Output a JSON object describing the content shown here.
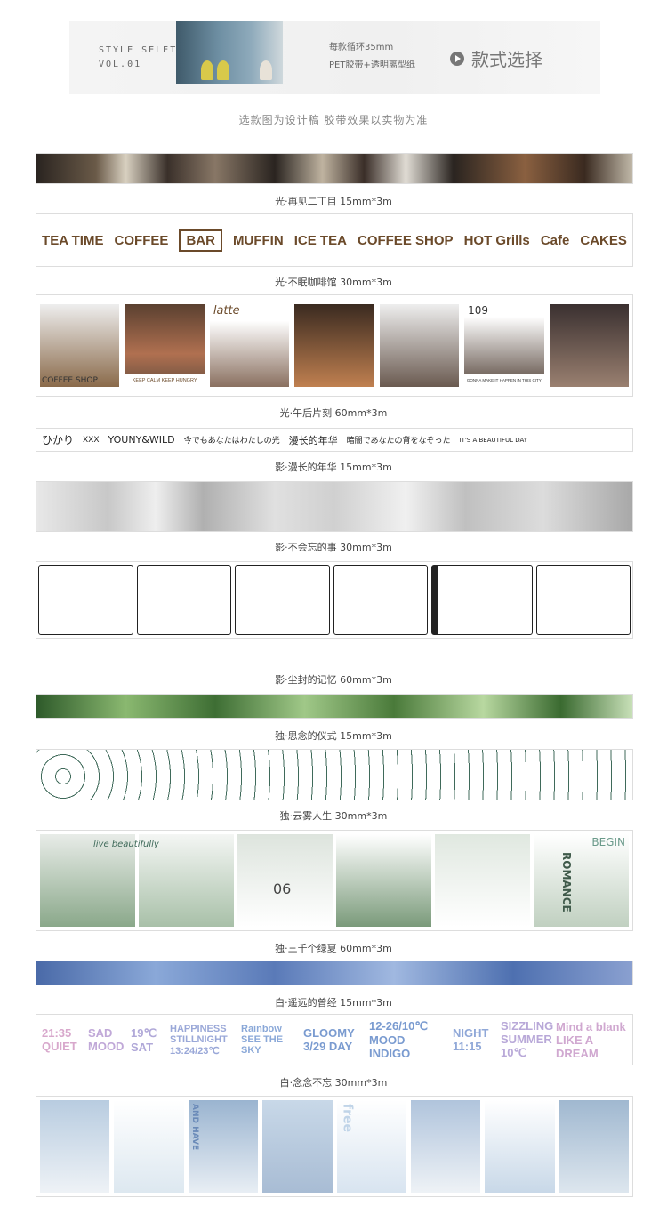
{
  "header": {
    "title_en": "STYLE SELETION",
    "vol": "VOL.01",
    "spec_line1": "每款循环35mm",
    "spec_line2": "PET胶带+透明离型纸",
    "select_label": "款式选择",
    "select_icon": "play-circle-icon"
  },
  "note": "选款图为设计稿 胶带效果以实物为准",
  "tapes": [
    {
      "caption": "光·再见二丁目 15mm*3m"
    },
    {
      "caption": "光·不眠咖啡馆 30mm*3m",
      "words": [
        "TEA TIME",
        "COFFEE",
        "BAR",
        "MUFFIN",
        "ICE TEA",
        "COFFEE SHOP",
        "HOT Grills",
        "Cafe",
        "CAKES"
      ]
    },
    {
      "caption": "光·午后片刻 60mm*3m",
      "words": [
        "COFFEE SHOP",
        "latte",
        "109",
        "KEEP CALM KEEP HUNGRY",
        "GONNA MAKE IT HAPPEN IN THIS CITY"
      ]
    },
    {
      "caption": "影·漫长的年华 15mm*3m",
      "words": [
        "ひかり",
        "XXX",
        "YOUNY&WILD",
        "今でもあなたはわたしの光",
        "漫长的年华",
        "暗闇であなたの背をなぞった",
        "IT'S A BEAUTIFUL DAY"
      ]
    },
    {
      "caption": "影·不会忘的事 30mm*3m"
    },
    {
      "caption": "影·尘封的记忆 60mm*3m"
    },
    {
      "caption": "独·思念的仪式 15mm*3m"
    },
    {
      "caption": "独·云雾人生 30mm*3m"
    },
    {
      "caption": "独·三千个绿夏 60mm*3m",
      "words": [
        "live beautifully",
        "06",
        "ROMANCE",
        "BEGIN"
      ]
    },
    {
      "caption": "白·遥远的曾经 15mm*3m"
    },
    {
      "caption": "白·念念不忘 30mm*3m",
      "words": [
        "21:35 QUIET",
        "SAD MOOD",
        "19℃ SAT",
        "HAPPINESS STILLNIGHT 13:24/23℃",
        "Rainbow SEE THE SKY",
        "GLOOMY 3/29 DAY",
        "12-26/10℃ MOOD INDIGO",
        "NIGHT 11:15",
        "SIZZLING SUMMER 10℃",
        "Mind a blank LIKE A DREAM"
      ]
    },
    {
      "caption": "",
      "words": [
        "AND HAVE",
        "free"
      ]
    }
  ],
  "colors": {
    "brown": "#6b4a2a",
    "green": "#3f6a5a",
    "pink": "#d8a8cc",
    "blue": "#7a9bd0"
  }
}
